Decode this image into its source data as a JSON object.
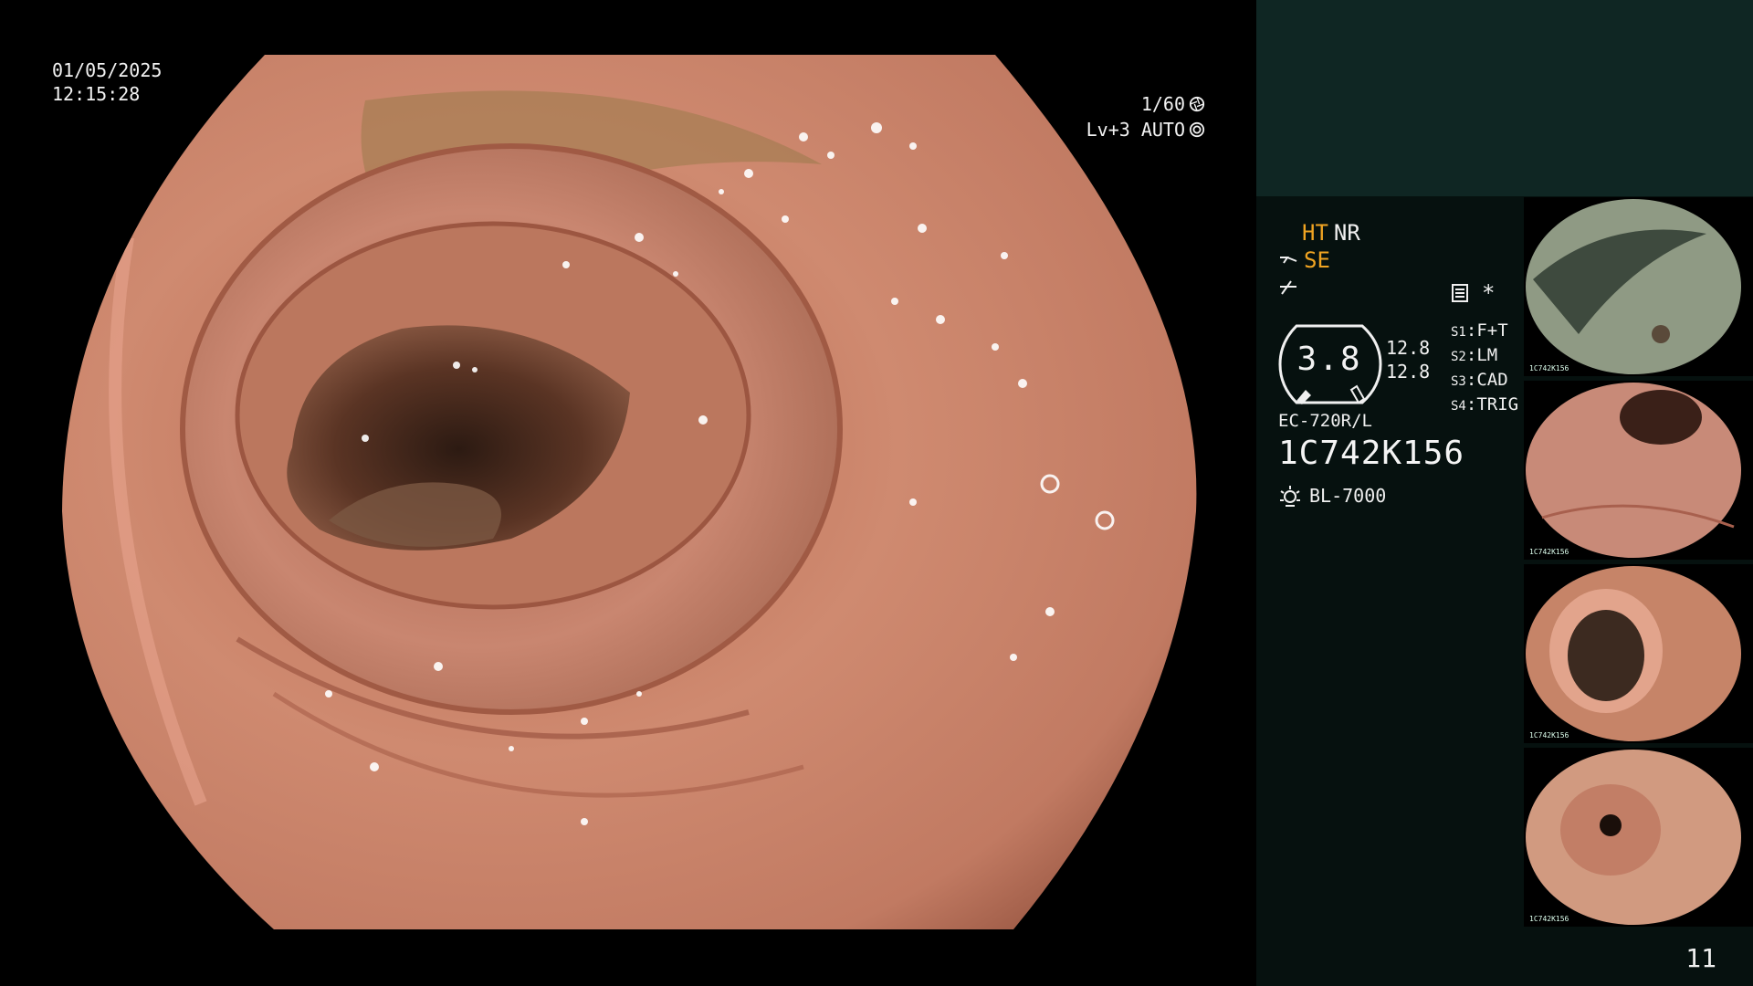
{
  "osd": {
    "date": "01/05/2025",
    "time": "12:15:28",
    "shutter": "1/60",
    "level": "Lv+3 AUTO"
  },
  "panel": {
    "ht": "HT",
    "nr": "NR",
    "se": "SE",
    "asterisk": "*",
    "gauge_value": "3.8",
    "side_value_top": "12.8",
    "side_value_bottom": "12.8",
    "modes": [
      {
        "key": "S1",
        "value": "F+T"
      },
      {
        "key": "S2",
        "value": "LM"
      },
      {
        "key": "S3",
        "value": "CAD"
      },
      {
        "key": "S4",
        "value": "TRIG"
      }
    ],
    "scope_model": "EC-720R/L",
    "scope_serial": "1C742K156",
    "light_source": "BL-7000",
    "page_number": "11"
  },
  "thumbnails": [
    {
      "caption": "1C742K156"
    },
    {
      "caption": "1C742K156"
    },
    {
      "caption": "1C742K156"
    },
    {
      "caption": "1C742K156"
    }
  ],
  "colors": {
    "panel_bg": "#06110f",
    "panel_top": "#0f2623",
    "amber": "#f0a422",
    "mucosa": "#c9846b"
  }
}
